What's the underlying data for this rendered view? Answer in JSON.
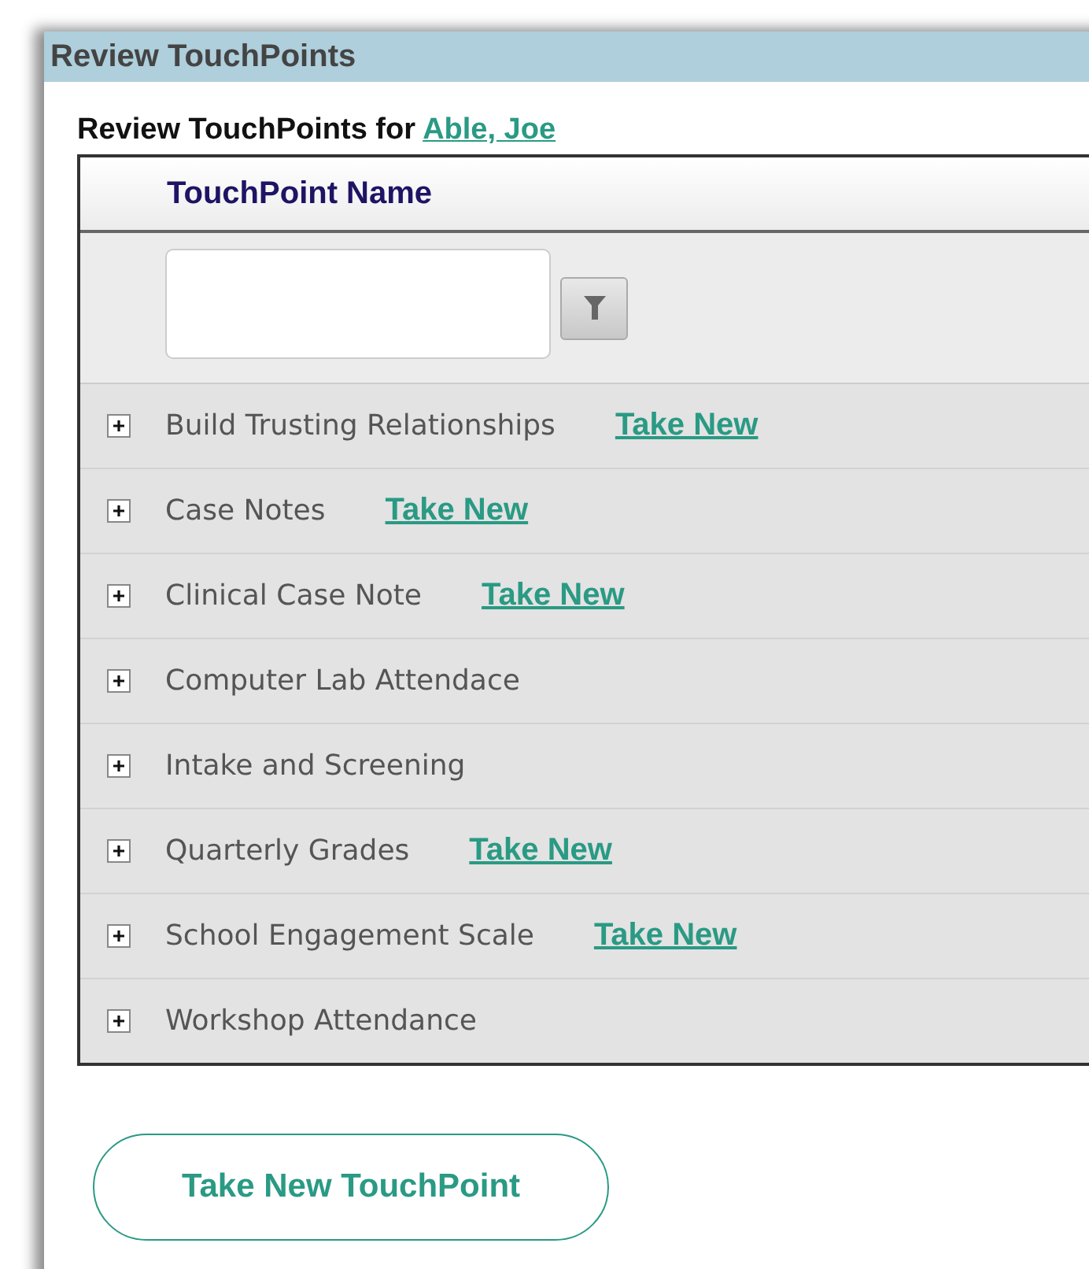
{
  "window": {
    "title": "Review TouchPoints"
  },
  "subtitle": {
    "text": "Review TouchPoints for ",
    "client_link": "Able, Joe"
  },
  "table": {
    "column": "TouchPoint Name",
    "rows": [
      {
        "name": "Build Trusting Relationships",
        "link": "Take New"
      },
      {
        "name": "Case Notes",
        "link": "Take New"
      },
      {
        "name": "Clinical Case Note",
        "link": "Take New"
      },
      {
        "name": "Computer Lab Attendace"
      },
      {
        "name": "Intake and Screening"
      },
      {
        "name": "Quarterly Grades",
        "link": "Take New"
      },
      {
        "name": "School Engagement Scale",
        "link": "Take New"
      },
      {
        "name": "Workshop Attendance"
      }
    ]
  },
  "button": "Take New TouchPoint"
}
